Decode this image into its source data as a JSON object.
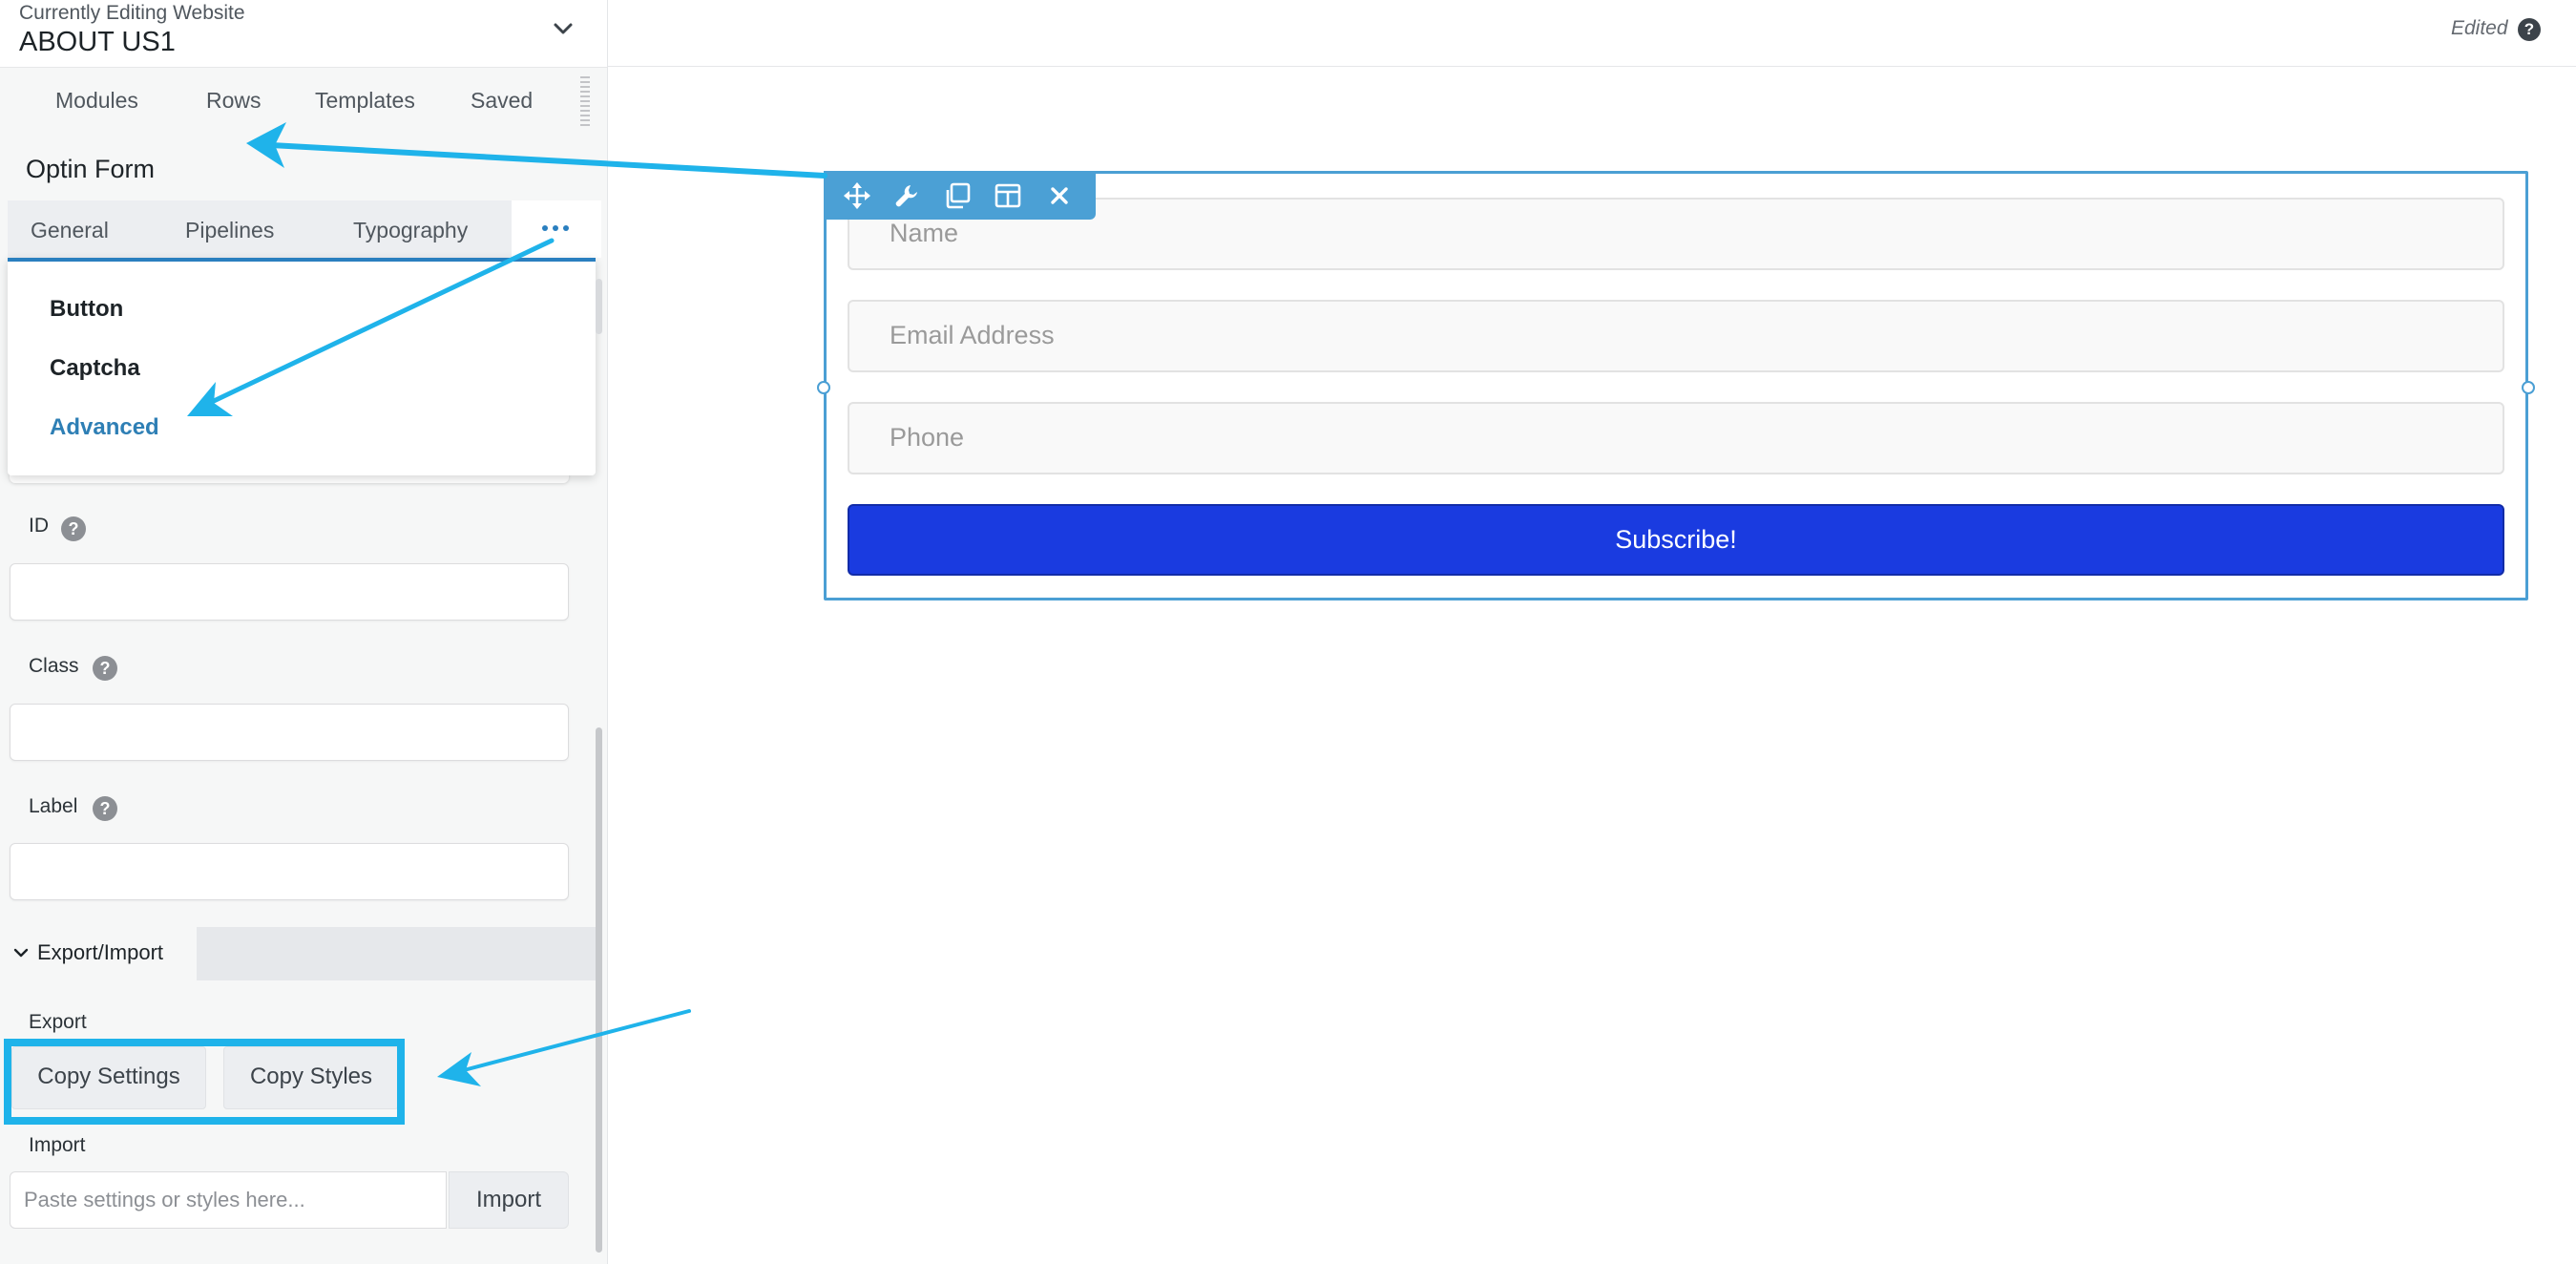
{
  "header": {
    "kicker": "Currently Editing Website",
    "site_name": "ABOUT US1"
  },
  "main_tabs": [
    {
      "label": "Modules"
    },
    {
      "label": "Rows"
    },
    {
      "label": "Templates"
    },
    {
      "label": "Saved"
    }
  ],
  "module": {
    "title": "Optin Form",
    "tabs": [
      {
        "label": "General"
      },
      {
        "label": "Pipelines"
      },
      {
        "label": "Typography"
      }
    ],
    "more_icon": "ellipsis-icon"
  },
  "dropdown": {
    "items": [
      {
        "label": "Button"
      },
      {
        "label": "Captcha"
      },
      {
        "label": "Advanced"
      }
    ],
    "active": "Advanced"
  },
  "fields": {
    "id_label": "ID",
    "id_value": "",
    "class_label": "Class",
    "class_value": "",
    "label_label": "Label",
    "label_value": "",
    "help_glyph": "?"
  },
  "export_import": {
    "section_title": "Export/Import",
    "export_label": "Export",
    "copy_settings": "Copy Settings",
    "copy_styles": "Copy Styles",
    "import_label": "Import",
    "import_placeholder": "Paste settings or styles here...",
    "import_button": "Import"
  },
  "canvas": {
    "status": "Edited",
    "status_help": "?",
    "toolbar_icons": [
      "move-icon",
      "wrench-icon",
      "duplicate-icon",
      "columns-icon",
      "close-icon"
    ],
    "form": {
      "name_placeholder": "Name",
      "email_placeholder": "Email Address",
      "phone_placeholder": "Phone",
      "submit_label": "Subscribe!"
    }
  },
  "colors": {
    "accent_blue": "#2a7fbf",
    "frame_blue": "#4b9fd4",
    "submit_blue": "#1a3be0",
    "annotation_cyan": "#1fb3ea"
  }
}
